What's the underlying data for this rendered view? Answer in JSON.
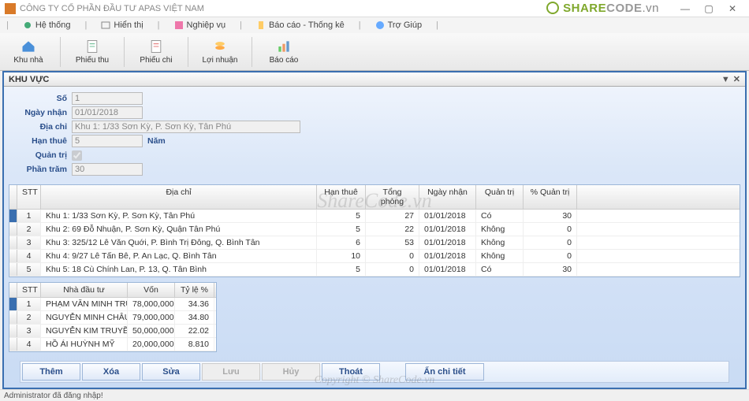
{
  "window": {
    "title": "CÔNG TY CỔ PHẦN ĐẦU TƯ APAS VIỆT NAM"
  },
  "logo": {
    "part1": "SHARE",
    "part2": "CODE",
    "suffix": ".vn"
  },
  "menubar": {
    "items": [
      {
        "label": "Hệ thống"
      },
      {
        "label": "Hiển thị"
      },
      {
        "label": "Nghiệp vụ"
      },
      {
        "label": "Báo cáo - Thống kê"
      },
      {
        "label": "Trợ Giúp"
      }
    ]
  },
  "toolbar": {
    "khu_nha": "Khu nhà",
    "phieu_thu": "Phiếu thu",
    "phieu_chi": "Phiếu chi",
    "loi_nhuan": "Lợi nhuận",
    "bao_cao": "Báo cáo"
  },
  "panel": {
    "title": "KHU VỰC"
  },
  "form": {
    "labels": {
      "so": "Số",
      "ngay_nhan": "Ngày nhận",
      "dia_chi": "Địa chỉ",
      "han_thue": "Hạn thuê",
      "han_thue_unit": "Năm",
      "quan_tri": "Quản trị",
      "phan_tram": "Phần trăm"
    },
    "values": {
      "so": "1",
      "ngay_nhan": "01/01/2018",
      "dia_chi": "Khu 1: 1/33 Sơn Kỳ, P. Sơn Kỳ, Tân Phú",
      "han_thue": "5",
      "quan_tri_checked": true,
      "phan_tram": "30"
    }
  },
  "grid1": {
    "headers": {
      "stt": "STT",
      "dia_chi": "Địa chỉ",
      "han_thue": "Hạn thuê",
      "tong_phong": "Tổng phòng",
      "ngay_nhan": "Ngày nhận",
      "quan_tri": "Quản trị",
      "pquan_tri": "% Quản trị"
    },
    "rows": [
      {
        "stt": "1",
        "addr": "Khu 1: 1/33 Sơn Kỳ, P. Sơn Kỳ, Tân Phú",
        "han": "5",
        "tong": "27",
        "ngay": "01/01/2018",
        "qt": "Có",
        "pqt": "30"
      },
      {
        "stt": "2",
        "addr": "Khu 2: 69 Đỗ Nhuận, P. Sơn Kỳ, Quận Tân Phú",
        "han": "5",
        "tong": "22",
        "ngay": "01/01/2018",
        "qt": "Không",
        "pqt": "0"
      },
      {
        "stt": "3",
        "addr": "Khu 3: 325/12 Lê Văn Quới, P. Bình Trị Đông, Q. Bình Tân",
        "han": "6",
        "tong": "53",
        "ngay": "01/01/2018",
        "qt": "Không",
        "pqt": "0"
      },
      {
        "stt": "4",
        "addr": "Khu 4: 9/27 Lê Tấn Bê, P. An Lạc, Q. Bình Tân",
        "han": "10",
        "tong": "0",
        "ngay": "01/01/2018",
        "qt": "Không",
        "pqt": "0"
      },
      {
        "stt": "5",
        "addr": "Khu 5: 18 Cù Chính Lan, P. 13, Q. Tân Bình",
        "han": "5",
        "tong": "0",
        "ngay": "01/01/2018",
        "qt": "Có",
        "pqt": "30"
      }
    ]
  },
  "grid2": {
    "headers": {
      "stt": "STT",
      "name": "Nhà đầu tư",
      "von": "Vốn",
      "ty": "Tỷ lệ %"
    },
    "rows": [
      {
        "stt": "1",
        "name": "PHẠM VĂN MINH TRUNG",
        "von": "78,000,000",
        "ty": "34.36"
      },
      {
        "stt": "2",
        "name": "NGUYỄN MINH CHÂU",
        "von": "79,000,000",
        "ty": "34.80"
      },
      {
        "stt": "3",
        "name": "NGUYỄN KIM TRUYỀN",
        "von": "50,000,000",
        "ty": "22.02"
      },
      {
        "stt": "4",
        "name": "HỒ ÁI HUỲNH MỸ",
        "von": "20,000,000",
        "ty": "8.810"
      }
    ]
  },
  "buttons": {
    "them": "Thêm",
    "xoa": "Xóa",
    "sua": "Sửa",
    "luu": "Lưu",
    "huy": "Hủy",
    "thoat": "Thoát",
    "an_chi_tiet": "Ẩn chi tiết"
  },
  "status": "Administrator đã đăng nhập!",
  "watermark": "ShareCode.vn",
  "watermark2": "Copyright © ShareCode.vn"
}
